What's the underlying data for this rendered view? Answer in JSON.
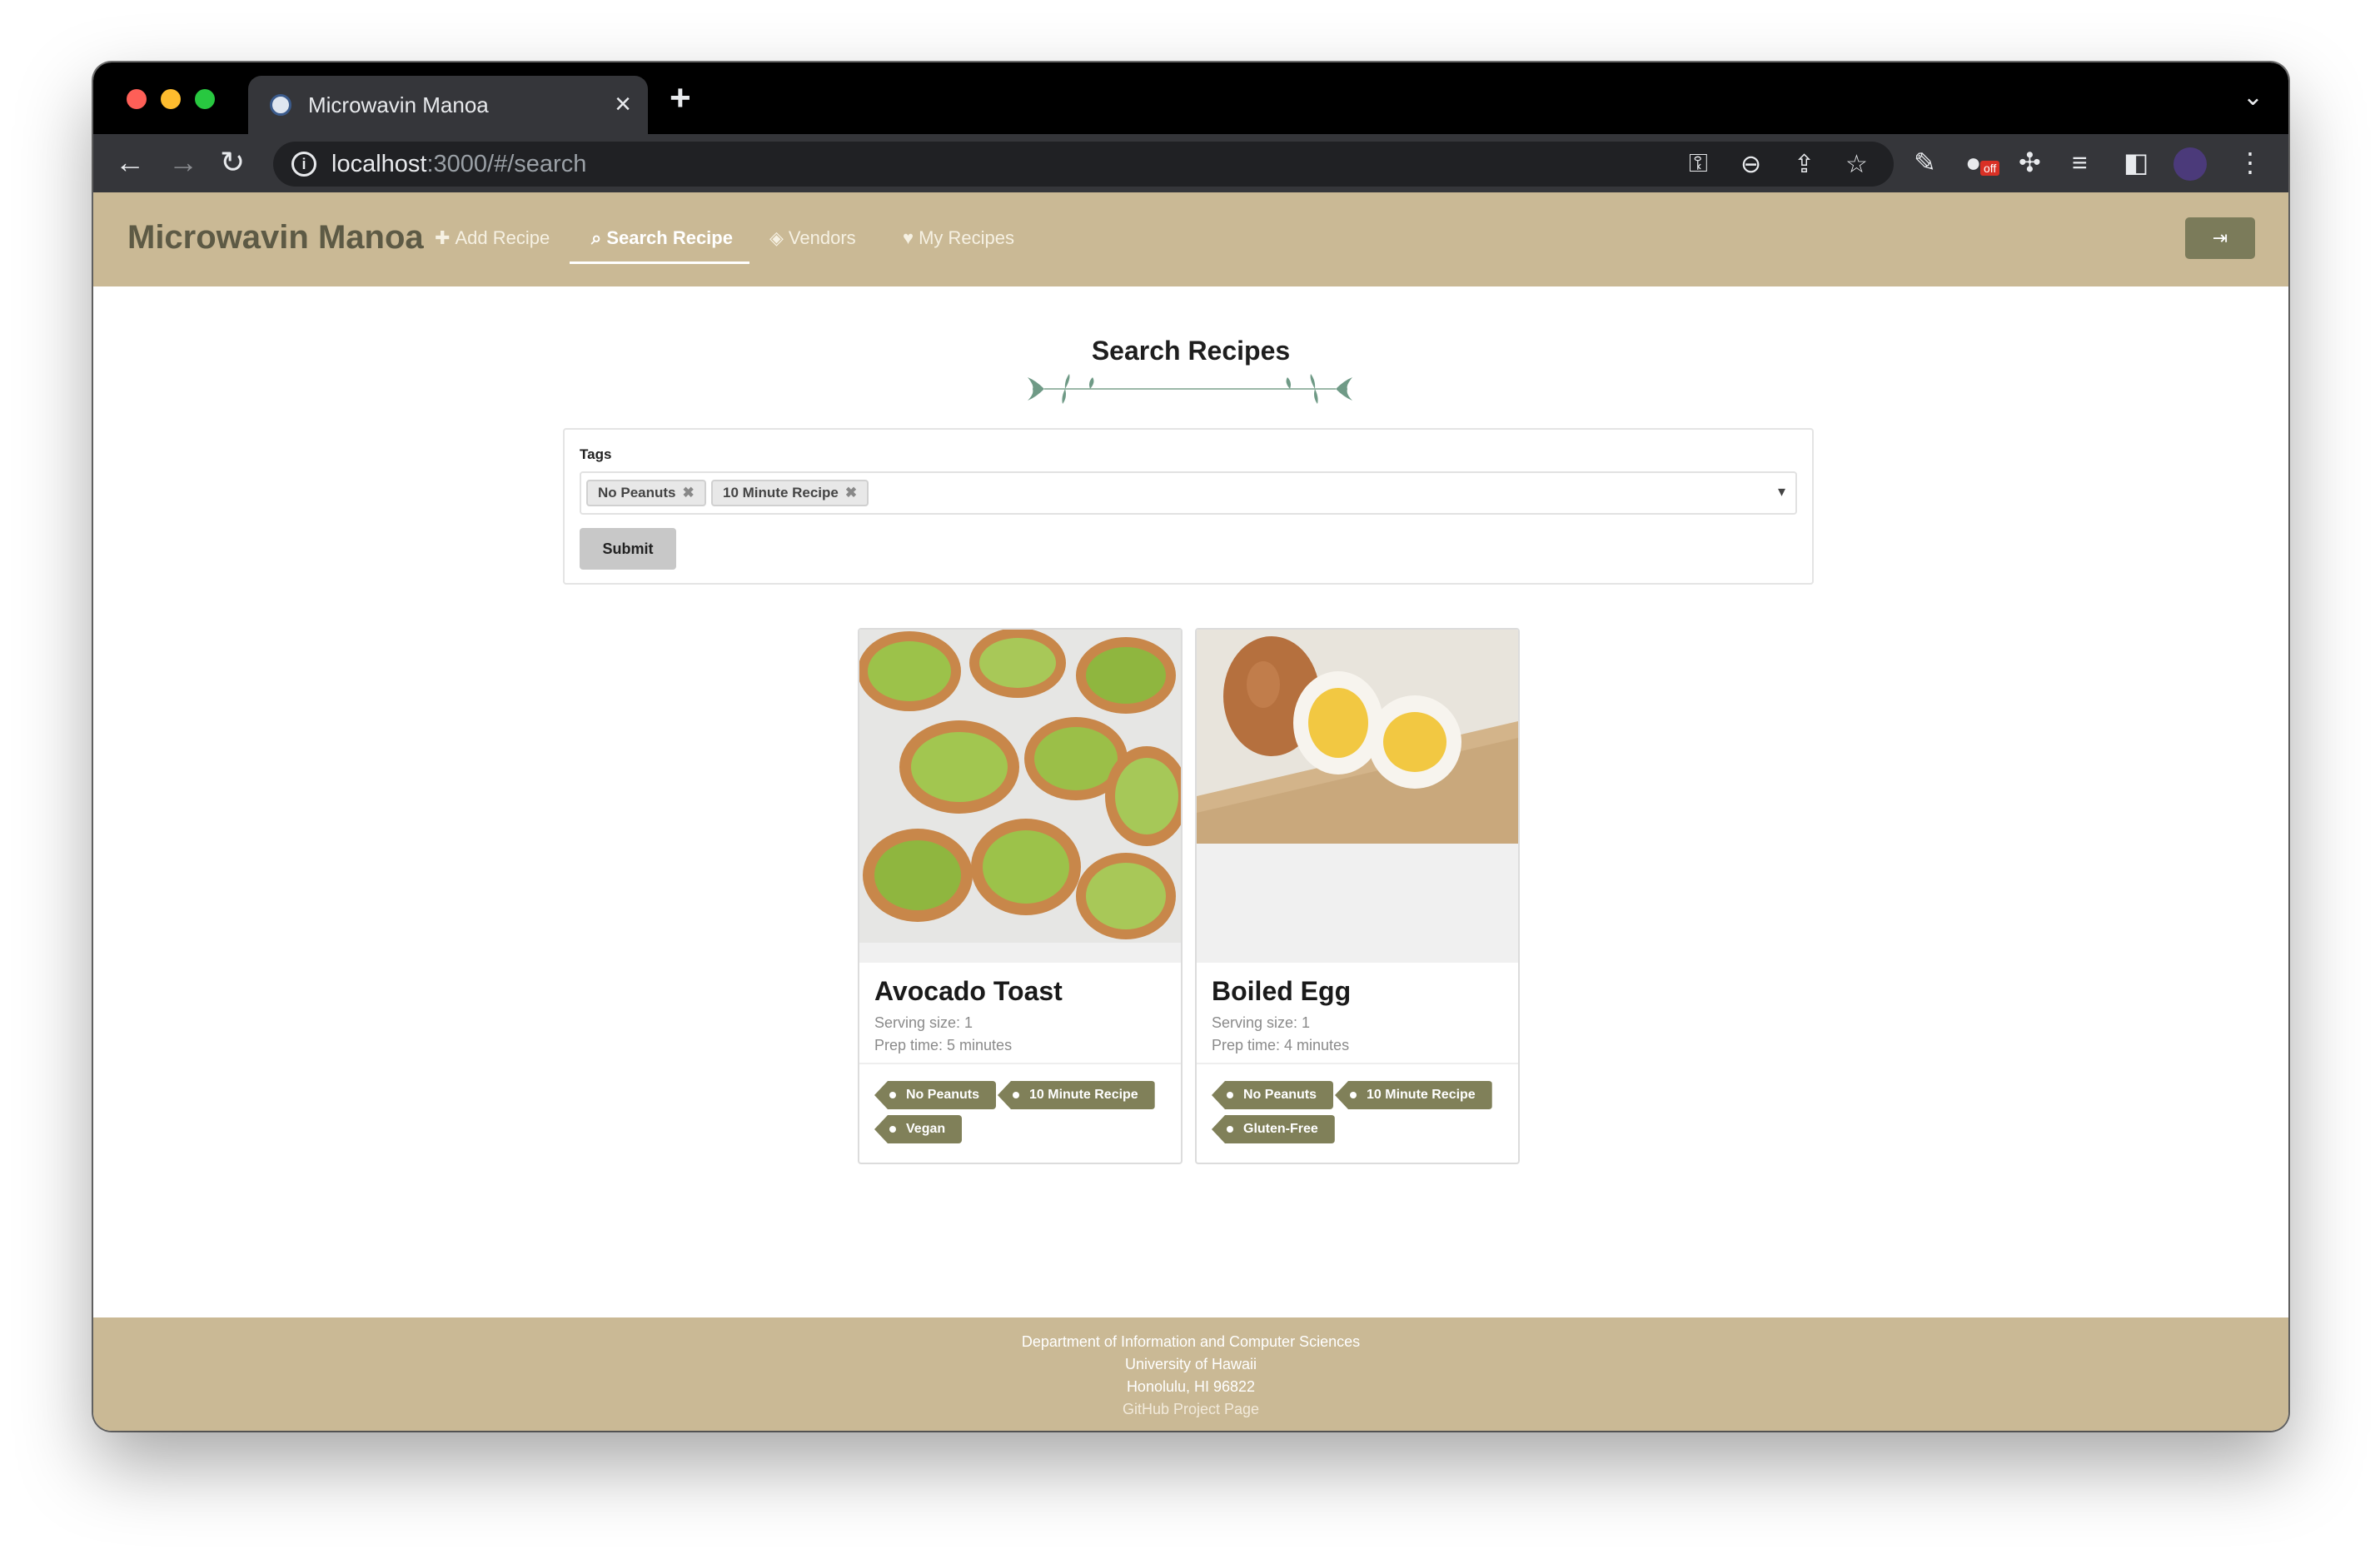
{
  "browser": {
    "tab_title": "Microwavin Manoa",
    "url_host": "localhost",
    "url_path": ":3000/#/search",
    "off_badge": "off"
  },
  "navbar": {
    "brand": "Microwavin Manoa",
    "links": [
      {
        "label": "Add Recipe",
        "icon": "plus-icon"
      },
      {
        "label": "Search Recipe",
        "icon": "search-icon"
      },
      {
        "label": "Vendors",
        "icon": "tags-icon"
      },
      {
        "label": "My Recipes",
        "icon": "heart-icon"
      }
    ],
    "active": "Search Recipe"
  },
  "page": {
    "title": "Search Recipes"
  },
  "search": {
    "tags_label": "Tags",
    "selected_tags": [
      "No Peanuts",
      "10 Minute Recipe"
    ],
    "submit_label": "Submit"
  },
  "recipes": [
    {
      "name": "Avocado Toast",
      "serving": "Serving size: 1",
      "prep": "Prep time: 5 minutes",
      "tags": [
        "No Peanuts",
        "10 Minute Recipe",
        "Vegan"
      ]
    },
    {
      "name": "Boiled Egg",
      "serving": "Serving size: 1",
      "prep": "Prep time: 4 minutes",
      "tags": [
        "No Peanuts",
        "10 Minute Recipe",
        "Gluten-Free"
      ]
    }
  ],
  "footer": {
    "line1": "Department of Information and Computer Sciences",
    "line2": "University of Hawaii",
    "line3": "Honolulu, HI 96822",
    "link": "GitHub Project Page"
  },
  "colors": {
    "navbar_bg": "#cab995",
    "tag_bg": "#808059",
    "brand_text": "#5d5a45"
  }
}
